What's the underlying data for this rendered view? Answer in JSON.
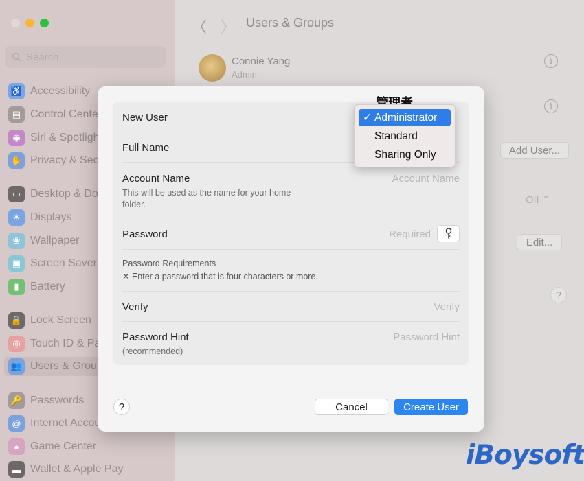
{
  "sidebar": {
    "search_placeholder": "Search",
    "items": [
      {
        "label": "Accessibility",
        "icon": "accessibility-icon",
        "color": "#7aa7dd"
      },
      {
        "label": "Control Center",
        "icon": "control-center-icon",
        "color": "#a39a9a"
      },
      {
        "label": "Siri & Spotlight",
        "icon": "siri-icon",
        "color": "#c487c7"
      },
      {
        "label": "Privacy & Security",
        "icon": "hand-icon",
        "color": "#7fa0d8"
      },
      {
        "label": "Desktop & Dock",
        "icon": "desktop-icon",
        "color": "#6f6868"
      },
      {
        "label": "Displays",
        "icon": "displays-icon",
        "color": "#79a6e0"
      },
      {
        "label": "Wallpaper",
        "icon": "wallpaper-icon",
        "color": "#8dc4d8"
      },
      {
        "label": "Screen Saver",
        "icon": "screen-saver-icon",
        "color": "#89c7d4"
      },
      {
        "label": "Battery",
        "icon": "battery-icon",
        "color": "#76c075"
      },
      {
        "label": "Lock Screen",
        "icon": "lock-icon",
        "color": "#6f6868"
      },
      {
        "label": "Touch ID & Password",
        "icon": "fingerprint-icon",
        "color": "#e7a1a1"
      },
      {
        "label": "Users & Groups",
        "icon": "users-icon",
        "color": "#7ba2dc"
      },
      {
        "label": "Passwords",
        "icon": "key-icon",
        "color": "#a39a9a"
      },
      {
        "label": "Internet Accounts",
        "icon": "at-icon",
        "color": "#7ba2dc"
      },
      {
        "label": "Game Center",
        "icon": "game-center-icon",
        "color": "#d9a3c2"
      },
      {
        "label": "Wallet & Apple Pay",
        "icon": "wallet-icon",
        "color": "#6f6868"
      }
    ]
  },
  "main": {
    "title": "Users & Groups",
    "user": {
      "name": "Connie Yang",
      "role": "Admin"
    },
    "add_user_label": "Add User...",
    "edit_label": "Edit...",
    "off_label": "Off",
    "help_label": "?"
  },
  "dialog": {
    "new_user_label": "New User",
    "full_name_label": "Full Name",
    "account_name_label": "Account Name",
    "account_name_hint": "This will be used as the name for your home folder.",
    "account_name_placeholder": "Account Name",
    "password_label": "Password",
    "password_placeholder": "Required",
    "password_requirements_label": "Password Requirements",
    "password_requirement_item": "✕  Enter a password that is four characters or more.",
    "verify_label": "Verify",
    "verify_placeholder": "Verify",
    "hint_label": "Password Hint",
    "hint_sub": "(recommended)",
    "hint_placeholder": "Password Hint",
    "help_label": "?",
    "cancel_label": "Cancel",
    "create_label": "Create User"
  },
  "dropdown": {
    "annotation": "管理者",
    "options": [
      "Administrator",
      "Standard",
      "Sharing Only"
    ],
    "selected": "Administrator",
    "check": "✓"
  },
  "watermark": "iBoysoft",
  "colors": {
    "accent": "#2b86f0",
    "watermark": "#2c67c8"
  }
}
